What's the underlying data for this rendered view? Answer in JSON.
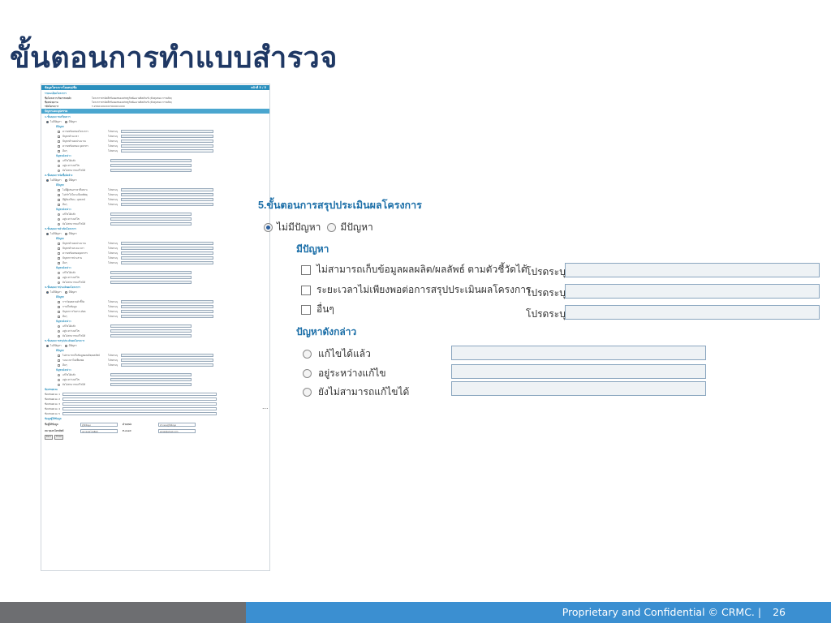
{
  "slide": {
    "title": "ขั้นตอนการทำแบบสำรวจ"
  },
  "thumbnail": {
    "header_left": "ข้อมูลโครงการโดยสรุปชื่อ",
    "header_right": "หน้าที่ 5 / 5",
    "info_heading": "รายละเอียดโครงการ",
    "info_rows": [
      {
        "k": "ชื่อโครงการ/กิจกรรมหลัก",
        "v": "โครงการสามัคคีพร้อมผลของเศรษฐกิจพัฒนาผลิตภัณฑ์ (ต้นทุนของ การผลิต)"
      },
      {
        "k": "ชื่อหน่วยงาน",
        "v": "โครงการสามัคคีพร้อมผลของเศรษฐกิจพัฒนาผลิตภัณฑ์ (ต้นทุนของ การผลิต)"
      },
      {
        "k": "รหัสโครงการ",
        "v": "T-25601062007000001000"
      }
    ],
    "section_bar": "ปัญหาและอุปสรรค",
    "step_titles": [
      "1.ขั้นตอนการเตรียมการ",
      "2.ขั้นตอนการจัดซื้อจัดจ้าง",
      "3.ขั้นตอนการดำเนินโครงการ",
      "4.ขั้นตอนการประเมินผลโครงการ",
      "5.ขั้นตอนการสรุปประเมินผลโครงการ"
    ],
    "no_problem": "ไม่มีปัญหา",
    "has_problem": "มีปัญหา",
    "problem_label": "มีปัญหา",
    "solve_label": "ปัญหาดังกล่าว",
    "please_specify": "โปรดระบุ",
    "solve_options": [
      "แก้ไขได้แล้ว",
      "อยู่ระหว่างแก้ไข",
      "ยังไม่สามารถแก้ไขได้"
    ],
    "step_items": [
      [
        "ความพร้อมของโครงการ",
        "ปัญหาด้านเวลา",
        "ปัญหาด้านงบประมาณ",
        "ความพร้อมของ บุคลากร",
        "อื่นๆ"
      ],
      [
        "ไม่มีผู้เสนอราคาที่เหมาะ",
        "ไม่เข้าใจในระเบียบพัสดุ",
        "มีผู้ร้องเรียน / อุทธรณ์",
        "อื่นๆ"
      ],
      [
        "ปัญหาด้านงบประมาณ",
        "ปัญหาด้านระยะเวลา",
        "ความพร้อมของบุคลากร",
        "ปัญหาการประสาน",
        "อื่นๆ"
      ],
      [
        "การวัดผลตามตัวชี้วัด",
        "การเก็บข้อมูล",
        "ปัญหาการวิเคราะห์ผล",
        "อื่นๆ"
      ],
      [
        "ไม่สามารถเก็บข้อมูลผลผลิต/ผลลัพธ์",
        "ระยะเวลาไม่เพียงพอ",
        "อื่นๆ"
      ]
    ],
    "notes_heading": "ข้อเสนอแนะ",
    "notes": [
      "ข้อเสนอแนะ 1",
      "ข้อเสนอแนะ 2",
      "ข้อเสนอแนะ 3",
      "ข้อเสนอแนะ 4",
      "ข้อเสนอแนะ 5"
    ],
    "contact_heading": "ข้อมูลผู้ให้ข้อมูล",
    "contact_rows": [
      {
        "k1": "ชื่อผู้ให้ข้อมูล",
        "v1": "ผู้ให้ข้อมูล",
        "k2": "ตำแหน่ง",
        "v2": "ตำแหน่งผู้ให้ข้อมูล"
      },
      {
        "k1": "หมายเลขโทรศัพท์",
        "v1": "หมายเลขโทรศัพท์",
        "k2": "E-mail",
        "v2": "email@email.com"
      }
    ],
    "buttons": [
      "Back",
      "Finish"
    ]
  },
  "zoom": {
    "heading": "5.ขั้นตอนการสรุปประเมินผลโครงการ",
    "radio_no_problem": "ไม่มีปัญหา",
    "radio_has_problem": "มีปัญหา",
    "selected": "no_problem",
    "problem_heading": "มีปัญหา",
    "problems": [
      "ไม่สามารถเก็บข้อมูลผลผลิต/ผลลัพธ์ ตามตัวชี้วัดได้",
      "ระยะเวลาไม่เพียงพอต่อการสรุปประเมินผลโครงการ",
      "อื่นๆ"
    ],
    "please_specify": "โปรดระบุ",
    "solve_heading": "ปัญหาดังกล่าว",
    "solve_options": [
      "แก้ไขได้แล้ว",
      "อยู่ระหว่างแก้ไข",
      "ยังไม่สามารถแก้ไขได้"
    ],
    "ellipsis": "..."
  },
  "footer": {
    "text": "Proprietary and Confidential © CRMC.  |",
    "page": "26"
  }
}
